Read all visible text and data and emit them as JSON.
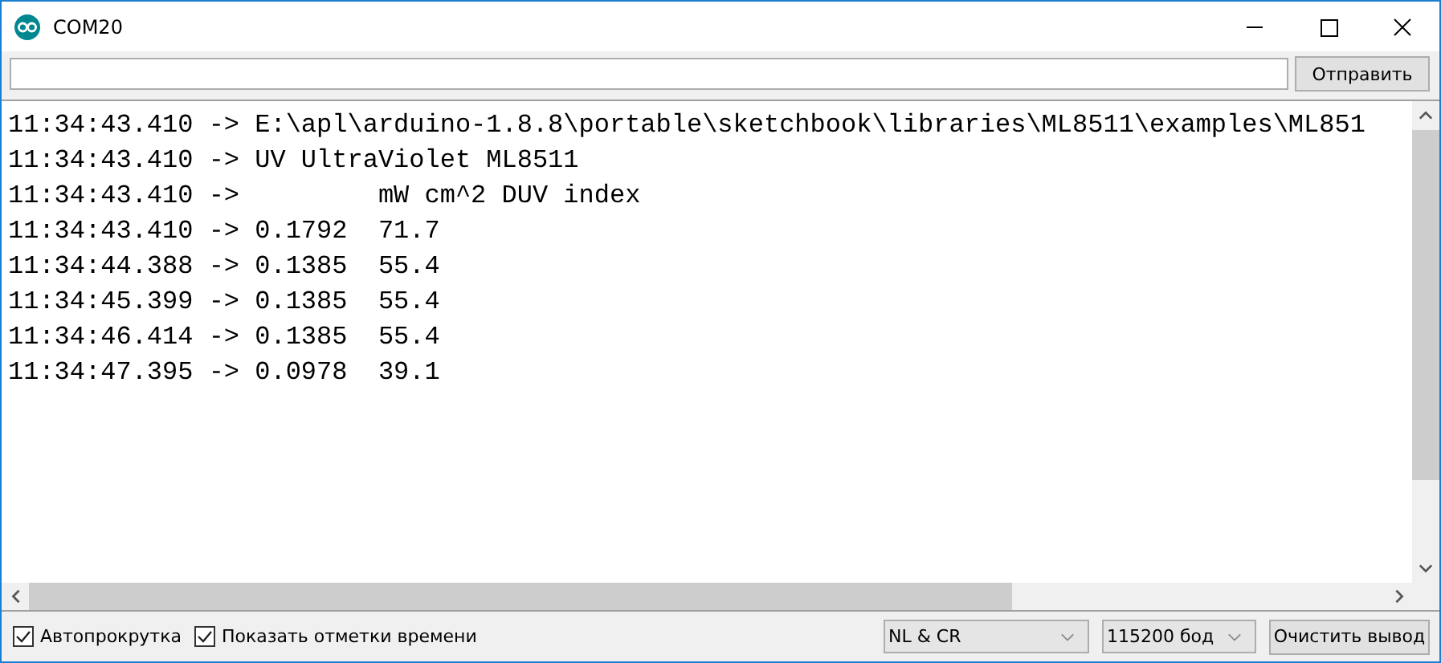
{
  "window": {
    "title": "COM20"
  },
  "send_button": {
    "label": "Отправить"
  },
  "output_lines": [
    "11:34:43.410 -> E:\\apl\\arduino-1.8.8\\portable\\sketchbook\\libraries\\ML8511\\examples\\ML851",
    "11:34:43.410 -> UV UltraViolet ML8511",
    "11:34:43.410 ->         mW cm^2 DUV index",
    "11:34:43.410 -> 0.1792  71.7",
    "11:34:44.388 -> 0.1385  55.4",
    "11:34:45.399 -> 0.1385  55.4",
    "11:34:46.414 -> 0.1385  55.4",
    "11:34:47.395 -> 0.0978  39.1"
  ],
  "options": [
    {
      "label": "Автопрокрутка",
      "checked": true
    },
    {
      "label": "Показать отметки времени",
      "checked": true
    }
  ],
  "line_ending": {
    "value": "NL & CR"
  },
  "baud_rate": {
    "value": "115200 бод"
  },
  "clear_button": {
    "label": "Очистить вывод"
  }
}
